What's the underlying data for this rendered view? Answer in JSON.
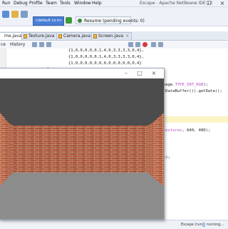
{
  "menubar": {
    "items": [
      "Run",
      "Debug",
      "Profile",
      "Team",
      "Tools",
      "Window",
      "Help"
    ],
    "window_title": "Escape - Apache NetBeans IDE 13"
  },
  "toolbar": {
    "run_config": "<default co ▾>",
    "resume_label": "Resume (pending events: 0)"
  },
  "tabs": [
    {
      "label": "me.java",
      "active": true
    },
    {
      "label": "Texture.java",
      "active": false
    },
    {
      "label": "Camera.java",
      "active": false
    },
    {
      "label": "Screen.java",
      "active": false
    }
  ],
  "editor_toolbar": {
    "source_label": "ce",
    "history_label": "History"
  },
  "code": {
    "line1": "{1,0,0,0,0,0,1,4,0,3,3,3,3,0,4},",
    "line2": "{1,0,0,0,0,0,1,4,0,3,3,3,3,0,4},",
    "line3": "{1,0,0,0,0,0,0,0,0,0,0,0,0,0,4}",
    "line4": "};",
    "line5_a": "mage.",
    "line5_kw": "TYPE_INT_RGB",
    "line5_b": ");",
    "line6": "tDataBuffer()).getData();",
    "line7_kw": "textures",
    "line7_b": ", 640, 480);",
    "line8": "});"
  },
  "status": {
    "project": "Escape (run)",
    "state": "running..."
  },
  "app_window": {
    "title": ""
  },
  "colors": {
    "ceiling": "#4c4c4c",
    "floor": "#8c8c8c",
    "brick": "#b85a3c",
    "mortar": "#c9b6a4",
    "ide_accent": "#4a7fd6"
  }
}
